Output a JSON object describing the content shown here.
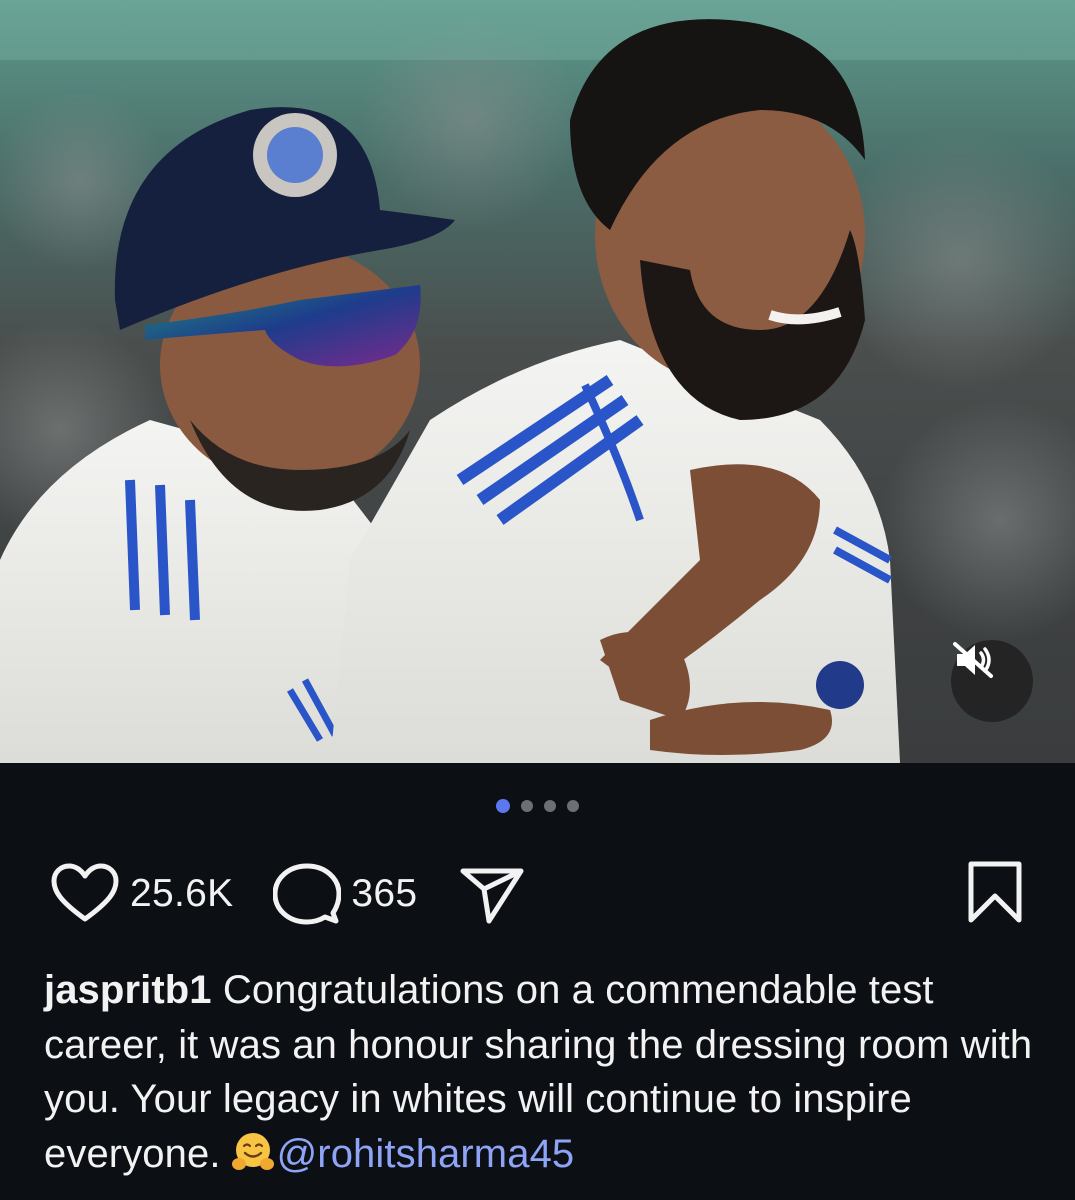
{
  "media": {
    "type": "photo",
    "carousel": {
      "total": 4,
      "active_index": 0
    },
    "mute_icon": "speaker-muted-icon"
  },
  "actions": {
    "like_icon": "heart-outline-icon",
    "like_count": "25.6K",
    "comment_icon": "comment-bubble-icon",
    "comment_count": "365",
    "share_icon": "paper-plane-icon",
    "save_icon": "bookmark-outline-icon"
  },
  "caption": {
    "username": "jaspritb1",
    "text": " Congratulations on a commendable test career, it was an honour sharing the dressing room with you. Your legacy in whites will continue to inspire everyone.",
    "emoji": "hugging-face-emoji",
    "mention": "@rohitsharma45"
  },
  "colors": {
    "background": "#0c0f14",
    "text": "#f2f2f2",
    "mention": "#8ea4f7",
    "active_dot": "#5b78f0",
    "inactive_dot": "#6c6f75"
  }
}
